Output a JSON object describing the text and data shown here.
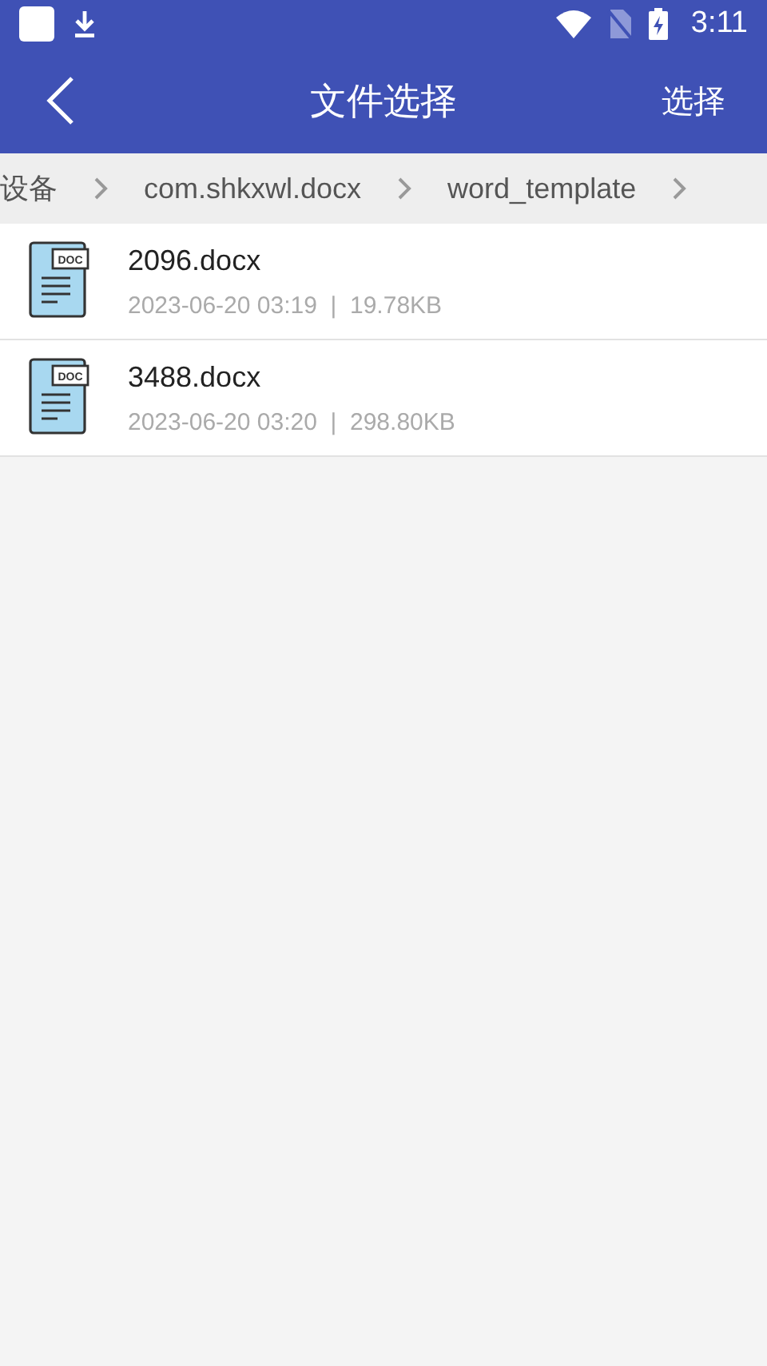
{
  "status_bar": {
    "time": "3:11"
  },
  "app_bar": {
    "title": "文件选择",
    "action": "选择"
  },
  "breadcrumb": [
    {
      "label": "设备"
    },
    {
      "label": "com.shkxwl.docx"
    },
    {
      "label": "word_template"
    }
  ],
  "files": [
    {
      "name": "2096.docx",
      "meta": "2023-06-20 03:19  |  19.78KB",
      "icon_label": "DOC"
    },
    {
      "name": "3488.docx",
      "meta": "2023-06-20 03:20  |  298.80KB",
      "icon_label": "DOC"
    }
  ]
}
